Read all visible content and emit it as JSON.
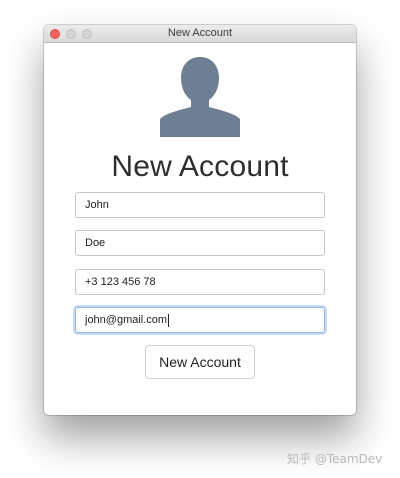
{
  "window": {
    "title": "New Account"
  },
  "form": {
    "heading": "New Account",
    "first_name": "John",
    "last_name": "Doe",
    "phone": "+3 123 456 78",
    "email": "john@gmail.com",
    "submit_label": "New Account"
  },
  "icons": {
    "avatar": "user-silhouette-icon",
    "avatar_color": "#6f7f93"
  },
  "watermark": "知乎 @TeamDev"
}
